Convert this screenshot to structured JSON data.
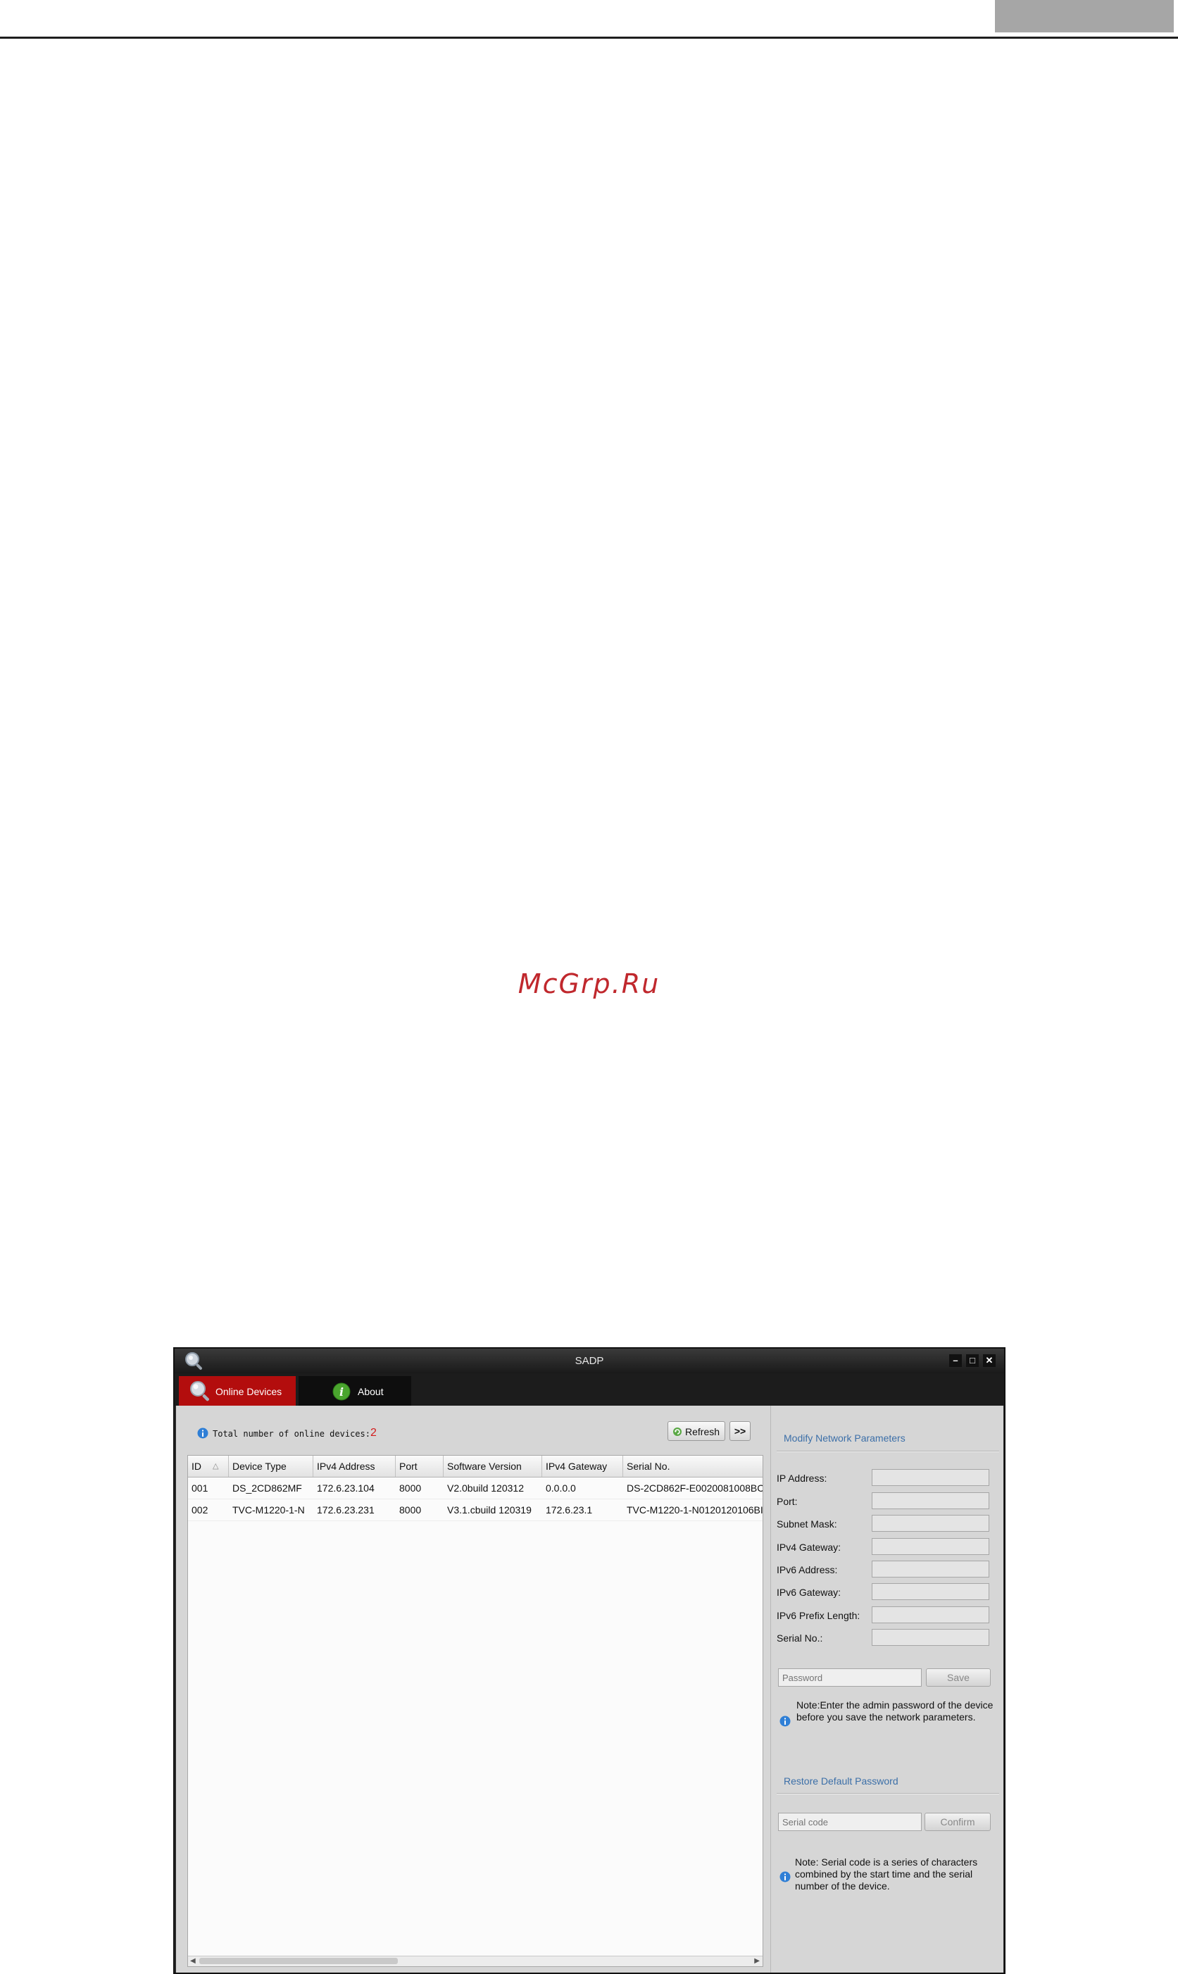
{
  "page": {
    "watermark": "McGrp.Ru"
  },
  "window": {
    "title": "SADP",
    "controls": {
      "minimize": "–",
      "maximize": "□",
      "close": "✕"
    }
  },
  "tabs": {
    "online_devices": "Online Devices",
    "about": "About"
  },
  "devices": {
    "total_label": "Total number of online devices:",
    "total_value": "2",
    "refresh_label": "Refresh",
    "expand_label": ">>",
    "columns": [
      "ID",
      "Device Type",
      "IPv4 Address",
      "Port",
      "Software Version",
      "IPv4 Gateway",
      "Serial No."
    ],
    "rows": [
      [
        "001",
        "DS_2CD862MF",
        "172.6.23.104",
        "8000",
        "V2.0build 120312",
        "0.0.0.0",
        "DS-2CD862F-E0020081008BC"
      ],
      [
        "002",
        "TVC-M1220-1-N",
        "172.6.23.231",
        "8000",
        "V3.1.cbuild 120319",
        "172.6.23.1",
        "TVC-M1220-1-N0120120106BI"
      ]
    ]
  },
  "modify_network": {
    "title": "Modify Network Parameters",
    "fields": [
      "IP Address:",
      "Port:",
      "Subnet Mask:",
      "IPv4 Gateway:",
      "IPv6 Address:",
      "IPv6 Gateway:",
      "IPv6 Prefix Length:",
      "Serial No.:"
    ],
    "password_placeholder": "Password",
    "save_label": "Save",
    "note": "Note:Enter the admin password of the device before you save the network parameters."
  },
  "restore_password": {
    "title": "Restore Default Password",
    "serial_placeholder": "Serial code",
    "confirm_label": "Confirm",
    "note": "Note: Serial code is a series of characters combined by the start time and the serial number of the device."
  },
  "colors": {
    "active_tab": "#b30d0d",
    "section_title": "#3c6fa8",
    "total_value": "#d31b1b"
  }
}
